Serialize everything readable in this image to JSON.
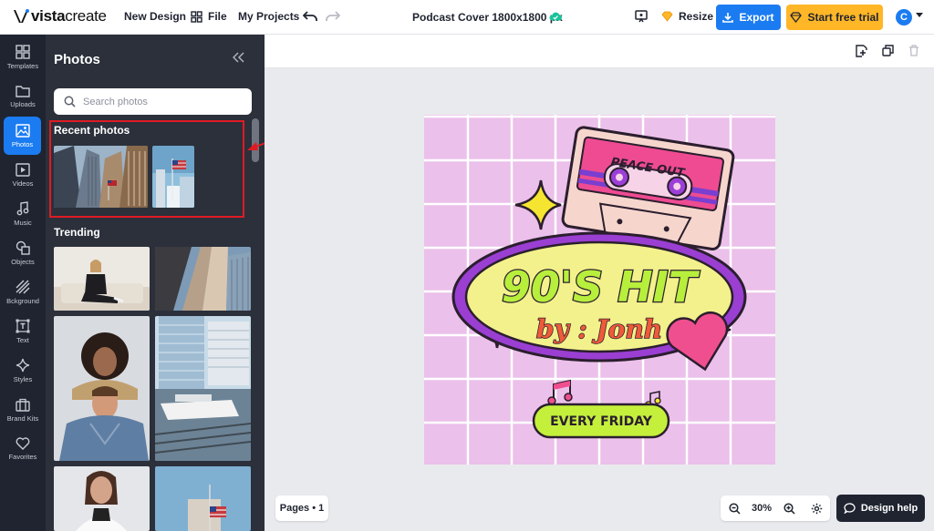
{
  "brand": {
    "logo_bold": "vista",
    "logo_light": "create"
  },
  "topbar": {
    "new_design": "New Design",
    "file": "File",
    "my_projects": "My Projects",
    "doc_title": "Podcast Cover 1800x1800 px",
    "resize": "Resize",
    "export": "Export",
    "trial": "Start free trial",
    "avatar_initial": "C"
  },
  "rail": [
    {
      "label": "Templates",
      "icon": "templates-icon"
    },
    {
      "label": "Uploads",
      "icon": "folder-icon"
    },
    {
      "label": "Photos",
      "icon": "image-icon"
    },
    {
      "label": "Videos",
      "icon": "video-icon"
    },
    {
      "label": "Music",
      "icon": "music-icon"
    },
    {
      "label": "Objects",
      "icon": "shapes-icon"
    },
    {
      "label": "Bckground",
      "icon": "background-icon"
    },
    {
      "label": "Text",
      "icon": "text-icon"
    },
    {
      "label": "Styles",
      "icon": "sparkle-icon"
    },
    {
      "label": "Brand Kits",
      "icon": "briefcase-icon"
    },
    {
      "label": "Favorites",
      "icon": "heart-icon"
    }
  ],
  "panel": {
    "title": "Photos",
    "search_placeholder": "Search photos",
    "recent_title": "Recent photos",
    "trending_title": "Trending"
  },
  "design": {
    "cassette_label": "PEACE OUT",
    "headline": "90'S HIT",
    "byline": "by : Jonh",
    "pill": "EVERY FRIDAY"
  },
  "footer": {
    "pages": "Pages • 1",
    "zoom": "30%",
    "help": "Design help"
  },
  "colors": {
    "accent": "#1b7cf2",
    "trial": "#ffb627",
    "rail_bg": "#1f2430",
    "panel_bg": "#2b303b",
    "highlight": "#e01b23",
    "design_bg": "#ebc0ea"
  }
}
